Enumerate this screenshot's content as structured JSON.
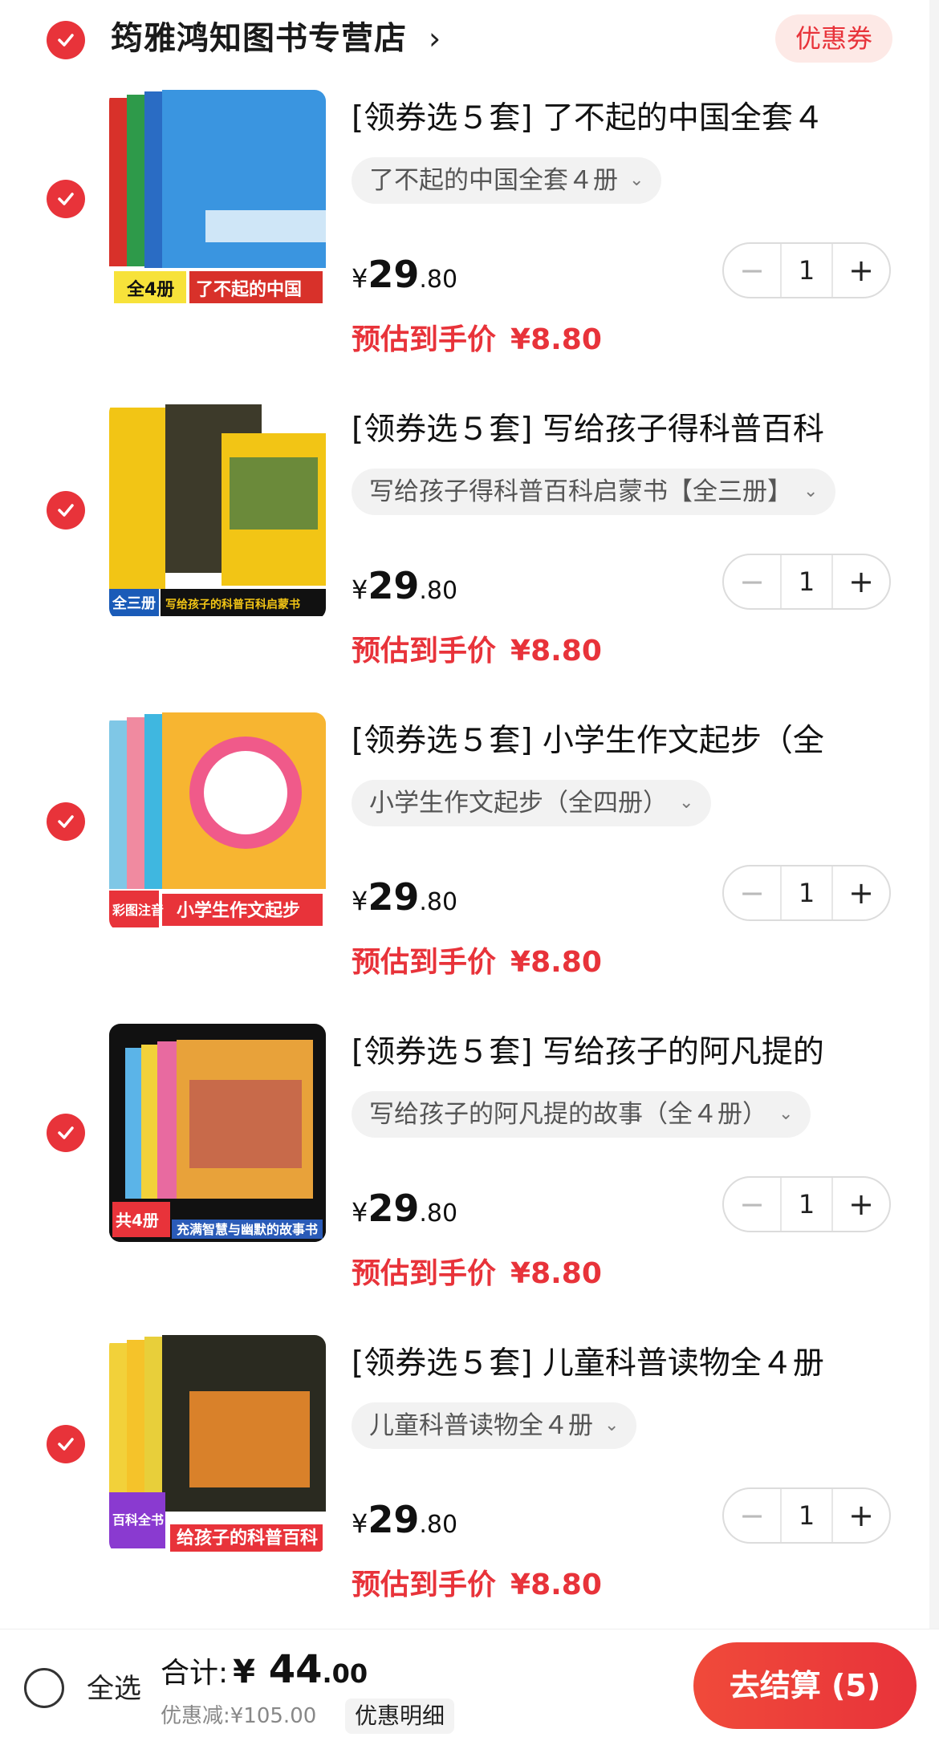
{
  "shop": {
    "name": "筠雅鸿知图书专营店",
    "arrow": "›",
    "coupon_label": "优惠券"
  },
  "items": [
    {
      "title": "[领券选５套] 了不起的中国全套４",
      "variant": "了不起的中国全套４册",
      "price_symbol": "¥",
      "price_int": "29",
      "price_dec": ".80",
      "quantity": "1",
      "est_label": "预估到手价",
      "est_price": "¥8.80",
      "cover": {
        "main_text": "了不起的中国",
        "badge": "全4册",
        "bg": "#2a86d6"
      }
    },
    {
      "title": "[领券选５套] 写给孩子得科普百科",
      "variant": "写给孩子得科普百科启蒙书【全三册】",
      "price_symbol": "¥",
      "price_int": "29",
      "price_dec": ".80",
      "quantity": "1",
      "est_label": "预估到手价",
      "est_price": "¥8.80",
      "cover": {
        "main_text": "写给孩子的科普百科启蒙书",
        "badge": "全三册",
        "bg": "#f2c515"
      }
    },
    {
      "title": "[领券选５套] 小学生作文起步（全",
      "variant": "小学生作文起步（全四册）",
      "price_symbol": "¥",
      "price_int": "29",
      "price_dec": ".80",
      "quantity": "1",
      "est_label": "预估到手价",
      "est_price": "¥8.80",
      "cover": {
        "main_text": "小学生作文起步",
        "badge": "彩图注音",
        "bg": "#f7b531"
      }
    },
    {
      "title": "[领券选５套] 写给孩子的阿凡提的",
      "variant": "写给孩子的阿凡提的故事（全４册）",
      "price_symbol": "¥",
      "price_int": "29",
      "price_dec": ".80",
      "quantity": "1",
      "est_label": "预估到手价",
      "est_price": "¥8.80",
      "cover": {
        "main_text": "充满智慧与幽默的故事书",
        "badge": "共4册",
        "bg": "#1a1a1a"
      }
    },
    {
      "title": "[领券选５套] 儿童科普读物全４册",
      "variant": "儿童科普读物全４册",
      "price_symbol": "¥",
      "price_int": "29",
      "price_dec": ".80",
      "quantity": "1",
      "est_label": "预估到手价",
      "est_price": "¥8.80",
      "cover": {
        "main_text": "给孩子的科普百科",
        "badge": "百科全书",
        "bg": "#e8cf3a"
      }
    }
  ],
  "stepper": {
    "minus": "−",
    "plus": "+"
  },
  "bottom": {
    "select_all": "全选",
    "total_label": "合计:",
    "total_symbol": "¥",
    "total_int": " 44",
    "total_dec": ".00",
    "discount_text": "优惠减:¥105.00",
    "discount_detail": "优惠明细",
    "checkout": "去结算 (5)"
  },
  "colors": {
    "accent": "#e8333a",
    "coupon_bg": "#fde9e6"
  }
}
